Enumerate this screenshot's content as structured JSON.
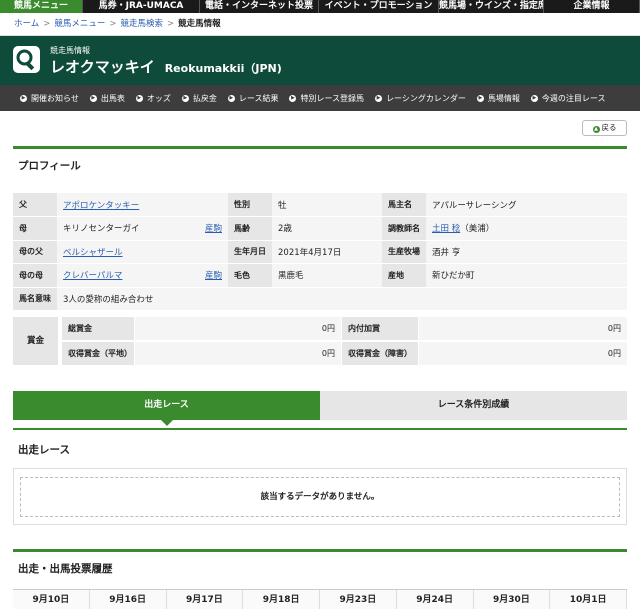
{
  "top_nav": [
    {
      "label": "競馬メニュー",
      "active": true
    },
    {
      "label": "馬券・JRA-UMACA",
      "active": false
    },
    {
      "label": "電話・インターネット投票",
      "active": false
    },
    {
      "label": "イベント・プロモーション",
      "active": false
    },
    {
      "label": "競馬場・ウインズ・指定席",
      "active": false
    },
    {
      "label": "企業情報",
      "active": false
    }
  ],
  "breadcrumb": {
    "items": [
      "ホーム",
      "競馬メニュー",
      "競走馬検索"
    ],
    "current": "競走馬情報",
    "separator": ">"
  },
  "header": {
    "subtitle": "競走馬情報",
    "name": "レオクマッキイ",
    "name_en": "Reokumakkii（JPN)",
    "icon": "search-icon"
  },
  "sub_nav": [
    "開催お知らせ",
    "出馬表",
    "オッズ",
    "払戻金",
    "レース結果",
    "特別レース登録馬",
    "レーシングカレンダー",
    "馬場情報",
    "今週の注目レース"
  ],
  "back_button": "戻る",
  "profile": {
    "title": "プロフィール",
    "rows": [
      [
        {
          "label": "父",
          "value": "アポロケンタッキー",
          "link": true,
          "tag": ""
        },
        {
          "label": "性別",
          "value": "牡"
        },
        {
          "label": "馬主名",
          "value": "アパルーサレーシング"
        }
      ],
      [
        {
          "label": "母",
          "value": "キリノセンターガイ",
          "link": false,
          "tag": "産駒"
        },
        {
          "label": "馬齢",
          "value": "2歳"
        },
        {
          "label": "調教師名",
          "value": "土田 稔",
          "suffix": "（美浦）"
        }
      ],
      [
        {
          "label": "母の父",
          "value": "ベルシャザール",
          "link": true,
          "tag": ""
        },
        {
          "label": "生年月日",
          "value": "2021年4月17日"
        },
        {
          "label": "生産牧場",
          "value": "酒井 亨"
        }
      ],
      [
        {
          "label": "母の母",
          "value": "クレバーパルマ",
          "link": true,
          "tag": "産駒"
        },
        {
          "label": "毛色",
          "value": "黒鹿毛"
        },
        {
          "label": "産地",
          "value": "新ひだか町"
        }
      ]
    ],
    "name_meaning_label": "馬名意味",
    "name_meaning": "3人の愛称の組み合わせ"
  },
  "prize": {
    "header": "賞金",
    "total_label": "総賞金",
    "total_value": "0",
    "added_label": "内付加賞",
    "added_value": "0",
    "flat_label": "収得賞金（平地）",
    "flat_value": "0",
    "jump_label": "収得賞金（障害）",
    "jump_value": "0",
    "unit": "円"
  },
  "tabs": [
    {
      "label": "出走レース",
      "active": true
    },
    {
      "label": "レース条件別成績",
      "active": false
    }
  ],
  "race_section": {
    "title": "出走レース",
    "empty_message": "該当するデータがありません。"
  },
  "history_section": {
    "title": "出走・出馬投票履歴",
    "dates": [
      "9月10日",
      "9月16日",
      "9月17日",
      "9月18日",
      "9月23日",
      "9月24日",
      "9月30日",
      "10月1日"
    ]
  },
  "colors": {
    "accent": "#3a8a2e",
    "header_bg": "#0f4b3a",
    "nav_bg": "#1a1a1a",
    "subnav_bg": "#3d3d3d",
    "link": "#2a5db0"
  }
}
